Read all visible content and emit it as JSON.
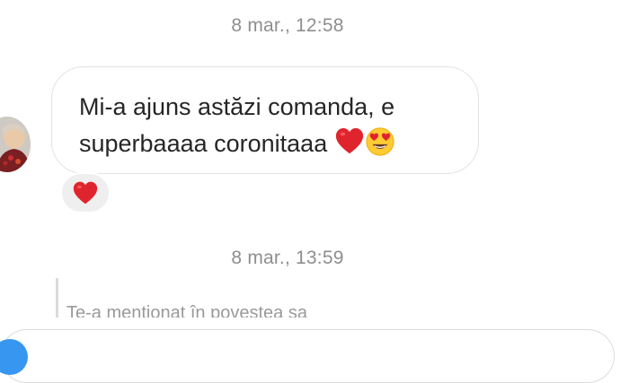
{
  "thread": {
    "timestamps": [
      "8 mar., 12:58",
      "8 mar., 13:59"
    ],
    "message": {
      "line1": "Mi-a ajuns astăzi comanda, e",
      "line2": "superbaaaa coronitaaa",
      "emojis": [
        "red-heart",
        "smiling-face-with-heart-eyes"
      ]
    },
    "reaction": "red-heart",
    "reply_preview": "Te-a menționat în povestea sa"
  },
  "colors": {
    "timestamp": "#8e8e8e",
    "bubble_border": "#e3e3e3",
    "reaction_bg": "#efefef",
    "heart": "#e0242e",
    "accent": "#3797f0"
  }
}
